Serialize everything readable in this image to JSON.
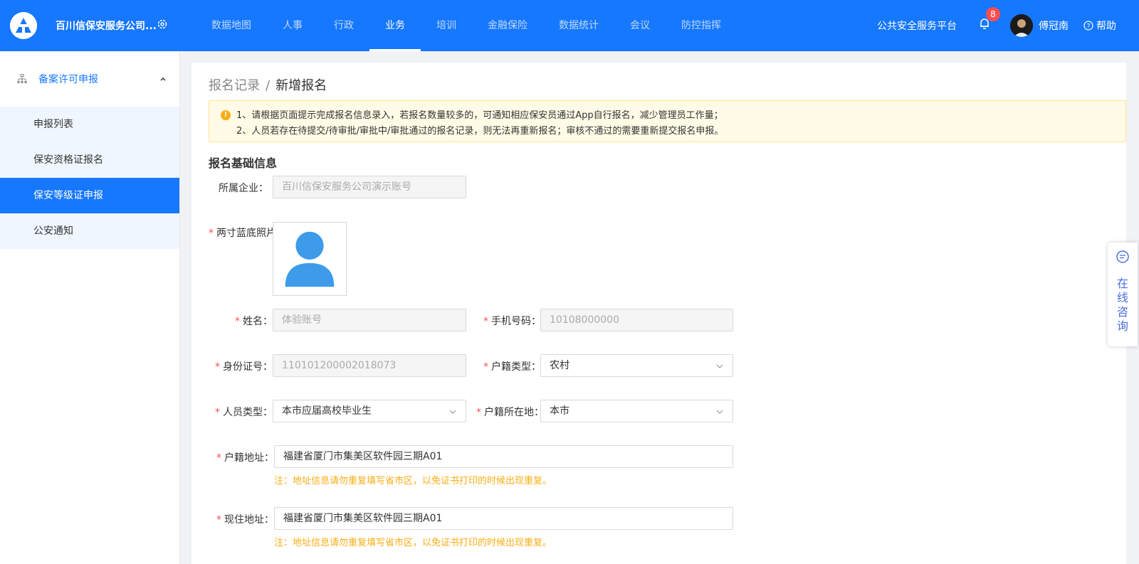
{
  "header": {
    "company": "百川信保安服务公司...",
    "nav": [
      "数据地图",
      "人事",
      "行政",
      "业务",
      "培训",
      "金融保险",
      "数据统计",
      "会议",
      "防控指挥"
    ],
    "active_nav_index": 3,
    "platform": "公共安全服务平台",
    "notification_count": "8",
    "username": "傅冠南",
    "help": "帮助"
  },
  "sidebar": {
    "group": "备案许可申报",
    "items": [
      "申报列表",
      "保安资格证报名",
      "保安等级证申报",
      "公安通知"
    ],
    "active_index": 2
  },
  "breadcrumb": {
    "parent": "报名记录",
    "separator": "/",
    "current": "新增报名"
  },
  "alert": {
    "line1": "1、请根据页面提示完成报名信息录入，若报名数量较多的，可通知相应保安员通过App自行报名，减少管理员工作量；",
    "line2": "2、人员若存在待提交/待审批/审批中/审批通过的报名记录，则无法再重新报名；审核不通过的需要重新提交报名申报。"
  },
  "section_title": "报名基础信息",
  "form": {
    "company_label": "所属企业：",
    "company_value": "百川信保安服务公司演示账号",
    "photo_label": "两寸蓝底照片",
    "name_label": "姓名：",
    "name_value": "体验账号",
    "phone_label": "手机号码：",
    "phone_value": "10108000000",
    "id_label": "身份证号：",
    "id_value": "110101200002018073",
    "hukou_type_label": "户籍类型：",
    "hukou_type_value": "农村",
    "person_type_label": "人员类型：",
    "person_type_value": "本市应届高校毕业生",
    "hukou_loc_label": "户籍所在地：",
    "hukou_loc_value": "本市",
    "hukou_addr_label": "户籍地址：",
    "hukou_addr_value": "福建省厦门市集美区软件园三期A01",
    "current_addr_label": "现住地址：",
    "current_addr_value": "福建省厦门市集美区软件园三期A01",
    "address_hint": "注：地址信息请勿重复填写省市区，以免证书打印的时候出现重复。"
  },
  "consult": {
    "text": "在线咨询"
  },
  "colors": {
    "primary": "#1677ff",
    "required": "#ff4d4f",
    "warning": "#faad14",
    "alert_bg": "#fffbe6"
  }
}
